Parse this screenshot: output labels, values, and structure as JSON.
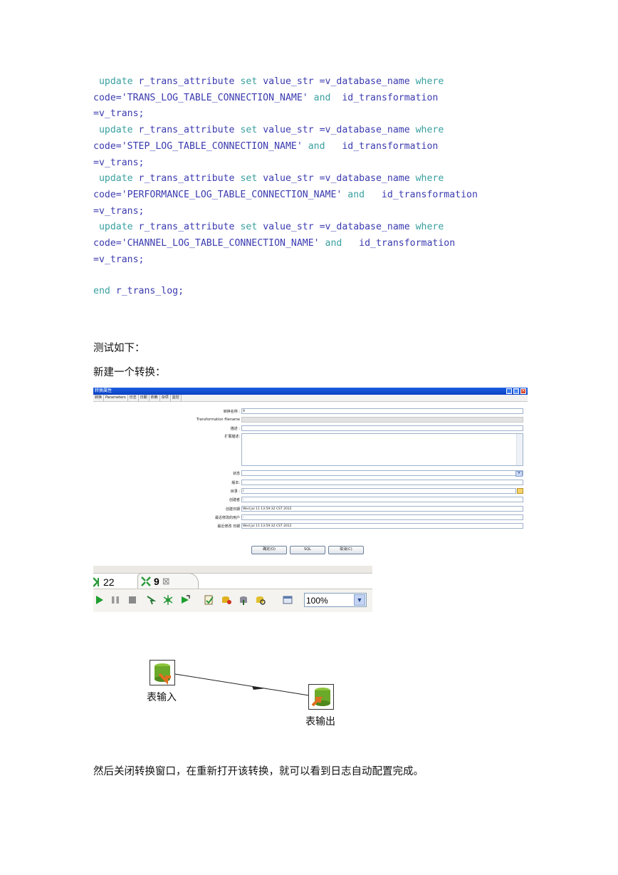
{
  "code": [
    {
      "pre": "update",
      "mid": " r_trans_attribute ",
      "kw2": "set",
      "rest": " value_str =v_database_name ",
      "kw3": "where"
    },
    {
      "line": "code='TRANS_LOG_TABLE_CONNECTION_NAME' ",
      "kw": "and",
      "tail": "  id_transformation"
    },
    {
      "line": "=v_trans;"
    },
    {
      "pre": "update",
      "mid": " r_trans_attribute ",
      "kw2": "set",
      "rest": " value_str =v_database_name ",
      "kw3": "where"
    },
    {
      "line": "code='STEP_LOG_TABLE_CONNECTION_NAME' ",
      "kw": "and",
      "tail": "   id_transformation"
    },
    {
      "line": "=v_trans;"
    },
    {
      "pre": "update",
      "mid": " r_trans_attribute ",
      "kw2": "set",
      "rest": " value_str =v_database_name ",
      "kw3": "where"
    },
    {
      "line": "code='PERFORMANCE_LOG_TABLE_CONNECTION_NAME' ",
      "kw": "and",
      "tail": "   id_transformation"
    },
    {
      "line": "=v_trans;"
    },
    {
      "pre": "update",
      "mid": " r_trans_attribute ",
      "kw2": "set",
      "rest": " value_str =v_database_name ",
      "kw3": "where"
    },
    {
      "line": "code='CHANNEL_LOG_TABLE_CONNECTION_NAME' ",
      "kw": "and",
      "tail": "   id_transformation"
    },
    {
      "line": "=v_trans;"
    }
  ],
  "code_end": {
    "kw": "end",
    "rest": " r_trans_log;"
  },
  "text": {
    "test_heading": "测试如下：",
    "new_transform": "新建一个转换：",
    "conclusion": "然后关闭转换窗口，在重新打开该转换，就可以看到日志自动配置完成。"
  },
  "dialog": {
    "title": "转换属性",
    "tabs": [
      "转换",
      "Parameters",
      "日志",
      "日期",
      "依赖",
      "杂项",
      "监控"
    ],
    "fields": {
      "name_label": "转换名称 :",
      "name_value": "9",
      "filename_label": "Transformation filename",
      "desc_label": "描述 :",
      "ext_desc_label": "扩展描述:",
      "status_label": "状态",
      "version_label": "版本:",
      "dir_label": "目录 :",
      "dir_value": "/",
      "creator_label": "创建者",
      "creator_value": "-",
      "created_label": "创建日期",
      "created_value": "Wed Jul 11 13:59:32 CST 2012",
      "modified_by_label": "最近修改的用户",
      "modified_by_value": "-",
      "modified_label": "最近修改 日期",
      "modified_value": "Wed Jul 11 13:59:32 CST 2012"
    },
    "buttons": {
      "ok": "确定(O)",
      "sql": "SQL",
      "cancel": "取消(C)"
    }
  },
  "editor": {
    "tab1": "22",
    "tab2": "9",
    "zoom": "100%"
  },
  "canvas": {
    "node_input": "表输入",
    "node_output": "表输出"
  }
}
